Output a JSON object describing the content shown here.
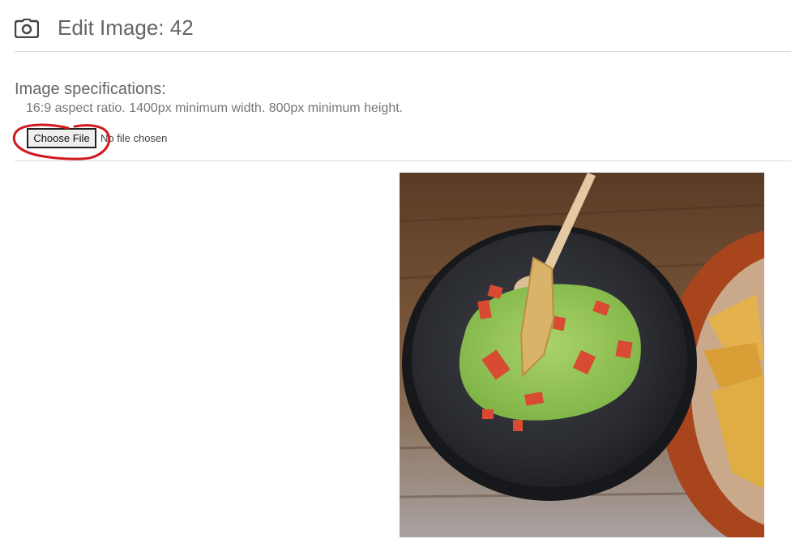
{
  "header": {
    "title": "Edit Image: 42",
    "icon": "camera-icon"
  },
  "specifications": {
    "title": "Image specifications:",
    "text": "16:9 aspect ratio. 1400px minimum width. 800px minimum height."
  },
  "file_input": {
    "button_label": "Choose File",
    "status": "No file chosen"
  },
  "annotation": {
    "color": "#d0191d"
  },
  "preview": {
    "subject": "guacamole-bowl-photo"
  }
}
